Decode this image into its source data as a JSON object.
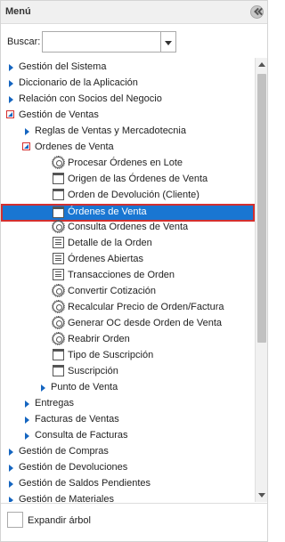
{
  "header": {
    "title": "Menú"
  },
  "search": {
    "label": "Buscar:",
    "value": "",
    "placeholder": ""
  },
  "tree": {
    "items": [
      {
        "label": "Gestión del Sistema",
        "type": "folder",
        "expanded": false
      },
      {
        "label": "Diccionario de la Aplicación",
        "type": "folder",
        "expanded": false
      },
      {
        "label": "Relación con Socios del Negocio",
        "type": "folder",
        "expanded": false
      },
      {
        "label": "Gestión de Ventas",
        "type": "folder",
        "expanded": true
      },
      {
        "label": "Reglas de Ventas y Mercadotecnia",
        "type": "folder",
        "expanded": false
      },
      {
        "label": "Ordenes de Venta",
        "type": "folder",
        "expanded": true
      },
      {
        "label": "Procesar Órdenes en Lote",
        "type": "process-icon"
      },
      {
        "label": "Origen de las Órdenes de Venta",
        "type": "window-icon"
      },
      {
        "label": "Orden de Devolución (Cliente)",
        "type": "window-icon"
      },
      {
        "label": "Órdenes de Venta",
        "type": "window-icon",
        "selected": true
      },
      {
        "label": "Consulta Ordenes de Venta",
        "type": "process-icon"
      },
      {
        "label": "Detalle de la Orden",
        "type": "report-icon"
      },
      {
        "label": "Órdenes Abiertas",
        "type": "report-icon"
      },
      {
        "label": "Transacciones de Orden",
        "type": "report-icon"
      },
      {
        "label": "Convertir Cotización",
        "type": "process-icon"
      },
      {
        "label": "Recalcular Precio de Orden/Factura",
        "type": "process-icon"
      },
      {
        "label": "Generar OC desde Orden de Venta",
        "type": "process-icon"
      },
      {
        "label": "Reabrir Orden",
        "type": "process-icon"
      },
      {
        "label": "Tipo de Suscripción",
        "type": "window-icon"
      },
      {
        "label": "Suscripción",
        "type": "window-icon"
      },
      {
        "label": "Punto de Venta",
        "type": "folder",
        "expanded": false
      },
      {
        "label": "Entregas",
        "type": "folder",
        "expanded": false
      },
      {
        "label": "Facturas de Ventas",
        "type": "folder",
        "expanded": false
      },
      {
        "label": "Consulta de Facturas",
        "type": "folder",
        "expanded": false
      },
      {
        "label": "Gestión de Compras",
        "type": "folder",
        "expanded": false
      },
      {
        "label": "Gestión de Devoluciones",
        "type": "folder",
        "expanded": false
      },
      {
        "label": "Gestión de Saldos Pendientes",
        "type": "folder",
        "expanded": false
      },
      {
        "label": "Gestión de Materiales",
        "type": "folder",
        "expanded": false
      }
    ]
  },
  "footer": {
    "expand_label": "Expandir árbol",
    "expand_checked": false
  },
  "colors": {
    "accent": "#1976d2",
    "highlight_border": "#d32f2f",
    "expander": "#1565c0"
  }
}
